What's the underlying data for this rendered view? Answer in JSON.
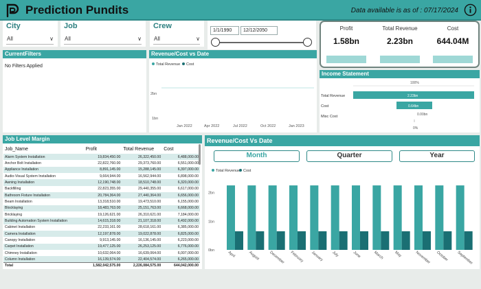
{
  "header": {
    "title": "Prediction Pundits",
    "as_of": "Data available is as of : 07/17/2024"
  },
  "slicers": {
    "city": {
      "label": "City",
      "value": "All"
    },
    "job": {
      "label": "Job",
      "value": "All"
    },
    "crew": {
      "label": "Crew",
      "value": "All"
    },
    "date_start": "1/1/1990",
    "date_end": "12/12/2050"
  },
  "kpis": {
    "profit": {
      "label": "Profit",
      "value": "1.58bn"
    },
    "revenue": {
      "label": "Total Revenue",
      "value": "2.23bn"
    },
    "cost": {
      "label": "Cost",
      "value": "644.04M"
    }
  },
  "current_filters": {
    "title": "CurrentFilters",
    "text": "No Filters Applied"
  },
  "line_chart": {
    "title": "Revenue/Cost vs Date",
    "legend": [
      {
        "name": "Total Revenue",
        "color": "#3aa6a3"
      },
      {
        "name": "Cost",
        "color": "#1a6f73"
      }
    ],
    "y_ticks": [
      "2bn",
      "1bn"
    ],
    "x_ticks": [
      "Jan 2022",
      "Apr 2022",
      "Jul 2022",
      "Oct 2022",
      "Jan 2023"
    ]
  },
  "income_statement": {
    "title": "Income Statement",
    "top_label": "100%",
    "rows": [
      {
        "label": "Total Revenue",
        "value": "2.23bn"
      },
      {
        "label": "Cost",
        "value": "0.64bn"
      },
      {
        "label": "Misc Cost",
        "value": "0.00bn"
      }
    ],
    "axis_label": "0%"
  },
  "job_table": {
    "title": "Job Level Margin",
    "columns": [
      "Job_Name",
      "Profit",
      "Total Revenue",
      "Cost"
    ],
    "rows": [
      [
        "Alarm System Installation",
        "19,834,450.00",
        "26,322,450.00",
        "6,488,000.00"
      ],
      [
        "Anchor Bolt Installation",
        "22,822,760.00",
        "29,373,760.00",
        "6,551,000.00"
      ],
      [
        "Appliance Installation",
        "8,891,145.00",
        "15,288,145.00",
        "6,397,000.00"
      ],
      [
        "Audio-Visual System Installation",
        "9,664,944.00",
        "16,562,944.00",
        "6,898,000.00"
      ],
      [
        "Awning Installation",
        "12,190,748.00",
        "18,510,748.00",
        "6,320,000.00"
      ],
      [
        "Backfilling",
        "22,823,355.00",
        "29,440,355.00",
        "6,617,000.00"
      ],
      [
        "Bathroom Fixture Installation",
        "20,784,364.00",
        "27,440,364.00",
        "6,656,000.00"
      ],
      [
        "Beam Installation",
        "13,318,510.00",
        "19,473,510.00",
        "6,155,000.00"
      ],
      [
        "Blocklaying",
        "18,483,763.00",
        "25,151,763.00",
        "6,668,000.00"
      ],
      [
        "Bricklaying",
        "19,126,621.00",
        "26,310,621.00",
        "7,184,000.00"
      ],
      [
        "Building Automation System Installation",
        "14,615,318.00",
        "21,107,318.00",
        "6,492,000.00"
      ],
      [
        "Cabinet Installation",
        "22,233,161.00",
        "28,618,161.00",
        "6,385,000.00"
      ],
      [
        "Camera Installation",
        "12,197,878.00",
        "19,022,878.00",
        "6,825,000.00"
      ],
      [
        "Canopy Installation",
        "9,913,145.00",
        "16,136,145.00",
        "6,223,000.00"
      ],
      [
        "Carpet Installation",
        "19,477,125.00",
        "26,253,125.00",
        "6,776,000.00"
      ],
      [
        "Chimney Installation",
        "10,632,064.00",
        "16,639,064.00",
        "6,007,000.00"
      ],
      [
        "Column Installation",
        "16,139,574.00",
        "22,404,574.00",
        "6,265,000.00"
      ]
    ],
    "total": [
      "Total",
      "1,582,042,575.00",
      "2,226,084,575.00",
      "644,042,000.00"
    ]
  },
  "bar_chart": {
    "title": "Revenue/Cost Vs Date",
    "buttons": [
      "Month",
      "Quarter",
      "Year"
    ]
  },
  "chart_data": {
    "type": "bar",
    "categories": [
      "April",
      "August",
      "December",
      "February",
      "January",
      "July",
      "June",
      "March",
      "May",
      "November",
      "October",
      "September"
    ],
    "series": [
      {
        "name": "Total Revenue",
        "color": "#3aa6a3",
        "values": [
          2.25,
          2.25,
          2.25,
          2.25,
          2.25,
          2.25,
          2.25,
          2.25,
          2.25,
          2.25,
          2.25,
          2.25
        ]
      },
      {
        "name": "Cost",
        "color": "#1a6f73",
        "values": [
          0.65,
          0.65,
          0.65,
          0.65,
          0.65,
          0.65,
          0.65,
          0.65,
          0.65,
          0.65,
          0.65,
          0.65
        ]
      }
    ],
    "y_ticks": [
      "2bn",
      "1bn",
      "0bn"
    ],
    "ylim": [
      0,
      2.3
    ]
  }
}
